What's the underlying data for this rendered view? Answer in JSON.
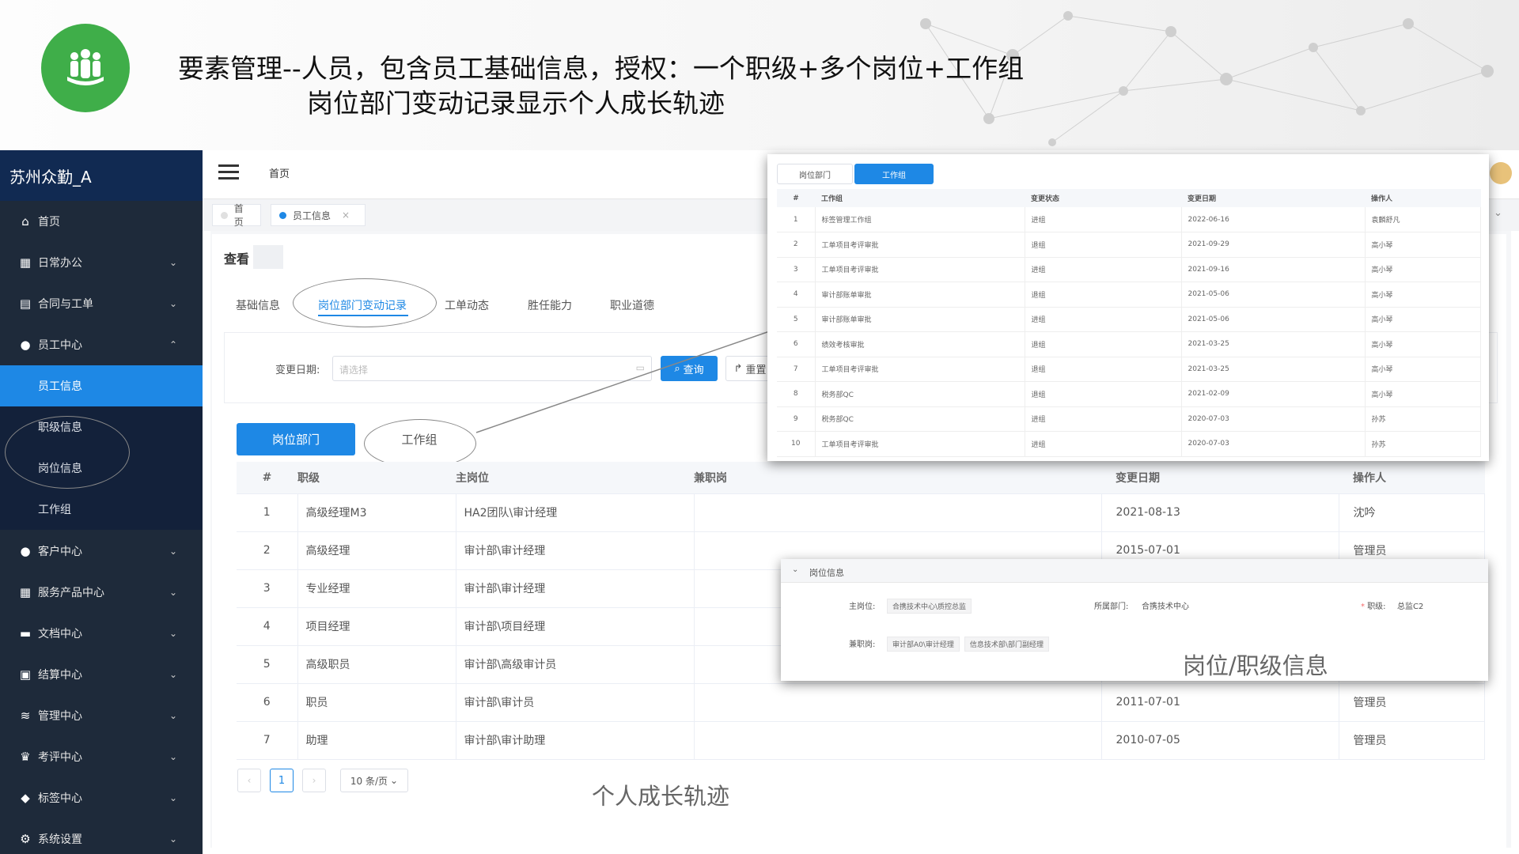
{
  "slide": {
    "title_line1": "要素管理--人员，包含员工基础信息，授权：一个职级+多个岗位+工作组",
    "title_line2": "岗位部门变动记录显示个人成长轨迹",
    "logo_icon": "people-group-icon",
    "logo_color": "#3fae49",
    "callout_growth": "个人成长轨迹",
    "callout_position": "岗位/职级信息"
  },
  "app": {
    "brand": "苏州众勤_A",
    "breadcrumb": "首页",
    "accent": "#1e88e5"
  },
  "sidebar": {
    "items": [
      {
        "label": "首页",
        "icon": "home-icon"
      },
      {
        "label": "日常办公",
        "icon": "office-icon"
      },
      {
        "label": "合同与工单",
        "icon": "contract-icon"
      },
      {
        "label": "员工中心",
        "icon": "user-icon"
      },
      {
        "label": "客户中心",
        "icon": "customers-icon"
      },
      {
        "label": "服务产品中心",
        "icon": "grid-icon"
      },
      {
        "label": "文档中心",
        "icon": "folder-icon"
      },
      {
        "label": "结算中心",
        "icon": "settlement-icon"
      },
      {
        "label": "管理中心",
        "icon": "layers-icon"
      },
      {
        "label": "考评中心",
        "icon": "trophy-icon"
      },
      {
        "label": "标签中心",
        "icon": "tag-icon"
      },
      {
        "label": "系统设置",
        "icon": "gear-icon"
      }
    ],
    "subitems": [
      "员工信息",
      "职级信息",
      "岗位信息",
      "工作组"
    ]
  },
  "tags": [
    {
      "label": "首页"
    },
    {
      "label": "员工信息",
      "close": "×"
    }
  ],
  "page": {
    "view_title": "查看",
    "tabs": [
      "基础信息",
      "岗位部门变动记录",
      "工单动态",
      "胜任能力",
      "职业道德"
    ],
    "filter_label": "变更日期:",
    "filter_placeholder": "请选择",
    "query_button": "查询",
    "reset_button": "重置",
    "subtabs": [
      "岗位部门",
      "工作组"
    ]
  },
  "main_table": {
    "headers": [
      "#",
      "职级",
      "主岗位",
      "兼职岗",
      "变更日期",
      "操作人"
    ],
    "rows": [
      [
        "1",
        "高级经理M3",
        "HA2团队\\审计经理",
        "",
        "2021-08-13",
        "沈吟"
      ],
      [
        "2",
        "高级经理",
        "审计部\\审计经理",
        "",
        "2015-07-01",
        "管理员"
      ],
      [
        "3",
        "专业经理",
        "审计部\\审计经理",
        "",
        "",
        ""
      ],
      [
        "4",
        "项目经理",
        "审计部\\项目经理",
        "",
        "",
        ""
      ],
      [
        "5",
        "高级职员",
        "审计部\\高级审计员",
        "",
        "",
        ""
      ],
      [
        "6",
        "职员",
        "审计部\\审计员",
        "",
        "2011-07-01",
        "管理员"
      ],
      [
        "7",
        "助理",
        "审计部\\审计助理",
        "",
        "2010-07-05",
        "管理员"
      ]
    ]
  },
  "pagination": {
    "current": "1",
    "page_size": "10 条/页"
  },
  "workgroup_panel": {
    "tabs": [
      "岗位部门",
      "工作组"
    ],
    "headers": [
      "#",
      "工作组",
      "变更状态",
      "变更日期",
      "操作人"
    ],
    "rows": [
      [
        "1",
        "标签管理工作组",
        "进组",
        "2022-06-16",
        "袁麟舒凡"
      ],
      [
        "2",
        "工单项目考评审批",
        "退组",
        "2021-09-29",
        "高小琴"
      ],
      [
        "3",
        "工单项目考评审批",
        "进组",
        "2021-09-16",
        "高小琴"
      ],
      [
        "4",
        "审计部账单审批",
        "退组",
        "2021-05-06",
        "高小琴"
      ],
      [
        "5",
        "审计部账单审批",
        "进组",
        "2021-05-06",
        "高小琴"
      ],
      [
        "6",
        "绩效考核审批",
        "退组",
        "2021-03-25",
        "高小琴"
      ],
      [
        "7",
        "工单项目考评审批",
        "退组",
        "2021-03-25",
        "高小琴"
      ],
      [
        "8",
        "税务部QC",
        "退组",
        "2021-02-09",
        "高小琴"
      ],
      [
        "9",
        "税务部QC",
        "进组",
        "2020-07-03",
        "孙苏"
      ],
      [
        "10",
        "工单项目考评审批",
        "进组",
        "2020-07-03",
        "孙苏"
      ]
    ]
  },
  "position_panel": {
    "header": "岗位信息",
    "main_post_label": "主岗位:",
    "main_post_value": "合携技术中心\\质控总监",
    "dept_label": "所属部门:",
    "dept_value": "合携技术中心",
    "rank_label": "职级:",
    "rank_value": "总监C2",
    "part_time_label": "兼职岗:",
    "part_time_values": [
      "审计部A0\\审计经理",
      "信息技术部\\部门副经理"
    ]
  }
}
